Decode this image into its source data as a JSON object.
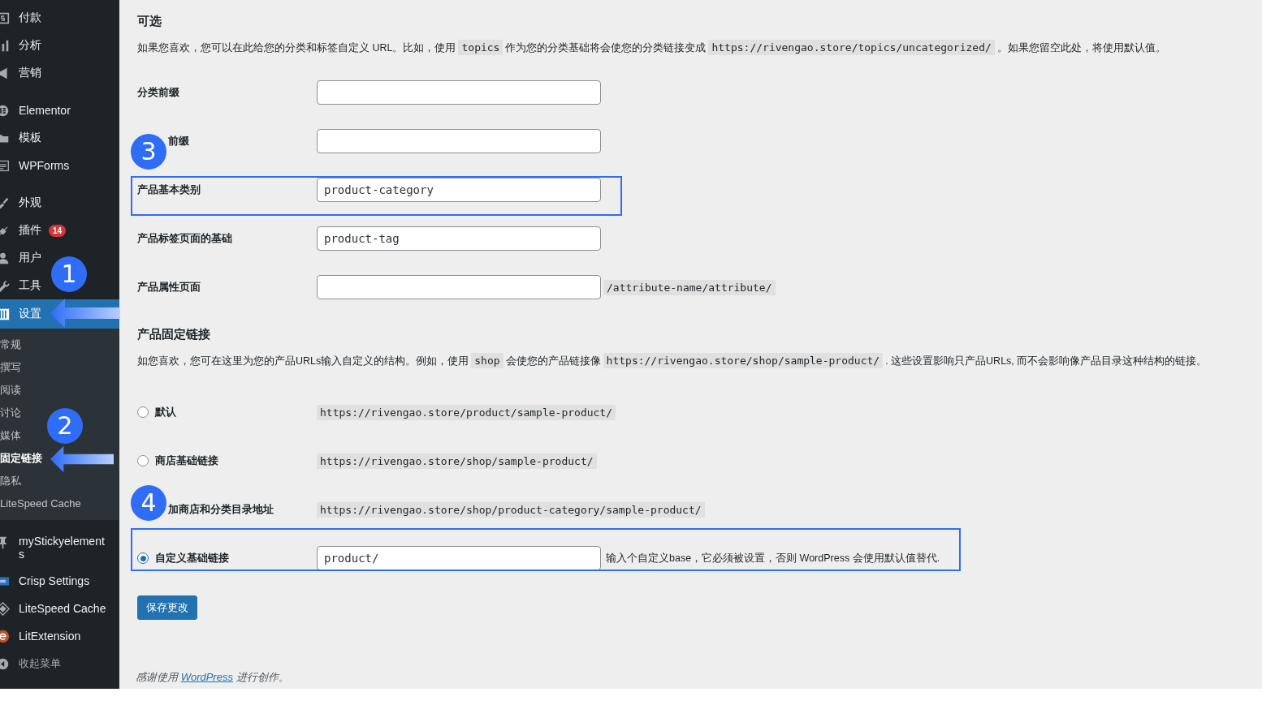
{
  "sidebar": {
    "items": [
      {
        "label": "付款",
        "selected": false
      },
      {
        "label": "分析",
        "selected": false
      },
      {
        "label": "营销",
        "selected": false
      },
      {
        "label": "Elementor",
        "selected": false
      },
      {
        "label": "模板",
        "selected": false
      },
      {
        "label": "WPForms",
        "selected": false
      },
      {
        "label": "外观",
        "selected": false
      },
      {
        "label": "插件",
        "selected": false,
        "badge": "14"
      },
      {
        "label": "用户",
        "selected": false
      },
      {
        "label": "工具",
        "selected": false
      },
      {
        "label": "设置",
        "selected": true,
        "children": [
          {
            "label": "常规",
            "selected": false
          },
          {
            "label": "撰写",
            "selected": false
          },
          {
            "label": "阅读",
            "selected": false
          },
          {
            "label": "讨论",
            "selected": false
          },
          {
            "label": "媒体",
            "selected": false
          },
          {
            "label": "固定链接",
            "selected": true
          },
          {
            "label": "隐私",
            "selected": false
          },
          {
            "label": "LiteSpeed Cache",
            "selected": false
          }
        ]
      },
      {
        "label": "myStickyelements",
        "selected": false
      },
      {
        "label": "Crisp Settings",
        "selected": false
      },
      {
        "label": "LiteSpeed Cache",
        "selected": false
      },
      {
        "label": "LitExtension",
        "selected": false
      }
    ],
    "collapse": "收起菜单"
  },
  "optional": {
    "title": "可选",
    "description": [
      {
        "kind": "text",
        "text": "如果您喜欢，您可以在此给您的分类和标签自定义 URL。比如，使用"
      },
      {
        "kind": "code",
        "text": "topics"
      },
      {
        "kind": "text",
        "text": "作为您的分类基础将会使您的分类链接变成"
      },
      {
        "kind": "code",
        "text": "https://rivengao.store/topics/uncategorized/"
      },
      {
        "kind": "text",
        "text": "。如果您留空此处，将使用默认值。"
      }
    ],
    "fields": [
      {
        "label": "分类前缀"
      },
      {
        "label": "前缀"
      },
      {
        "label": "产品基本类别",
        "value": "product-category"
      },
      {
        "label": "产品标签页面的基础",
        "value": "product-tag"
      },
      {
        "label": "产品属性页面",
        "suffix": "/attribute-name/attribute/"
      }
    ]
  },
  "product_permalinks": {
    "title": "产品固定链接",
    "description": [
      {
        "kind": "text",
        "text": "如您喜欢，您可在这里为您的产品URLs输入自定义的结构。例如，使用"
      },
      {
        "kind": "code",
        "text": "shop"
      },
      {
        "kind": "text",
        "text": "会使您的产品链接像"
      },
      {
        "kind": "code",
        "text": "https://rivengao.store/shop/sample-product/"
      },
      {
        "kind": "text",
        "text": ". 这些设置影响只产品URLs, 而不会影响像产品目录这种结构的链接。"
      }
    ],
    "options": [
      {
        "kind": "radio",
        "label": "默认",
        "selected": false,
        "example": "https://rivengao.store/product/sample-product/"
      },
      {
        "kind": "radio",
        "label": "商店基础链接",
        "selected": false,
        "example": "https://rivengao.store/shop/sample-product/"
      },
      {
        "kind": "covered",
        "label": "加商店和分类目录地址",
        "example": "https://rivengao.store/shop/product-category/sample-product/"
      },
      {
        "kind": "custom",
        "label": "自定义基础链接",
        "selected": true,
        "value": "product/",
        "hint": "输入个自定义base，它必须被设置，否则 WordPress 会使用默认值替代."
      }
    ]
  },
  "save_button": "保存更改",
  "footer": {
    "before": "感谢使用",
    "link": "WordPress",
    "after": "进行创作。"
  },
  "annotations": [
    {
      "number": "1"
    },
    {
      "number": "2"
    },
    {
      "number": "3"
    },
    {
      "number": "4"
    }
  ]
}
